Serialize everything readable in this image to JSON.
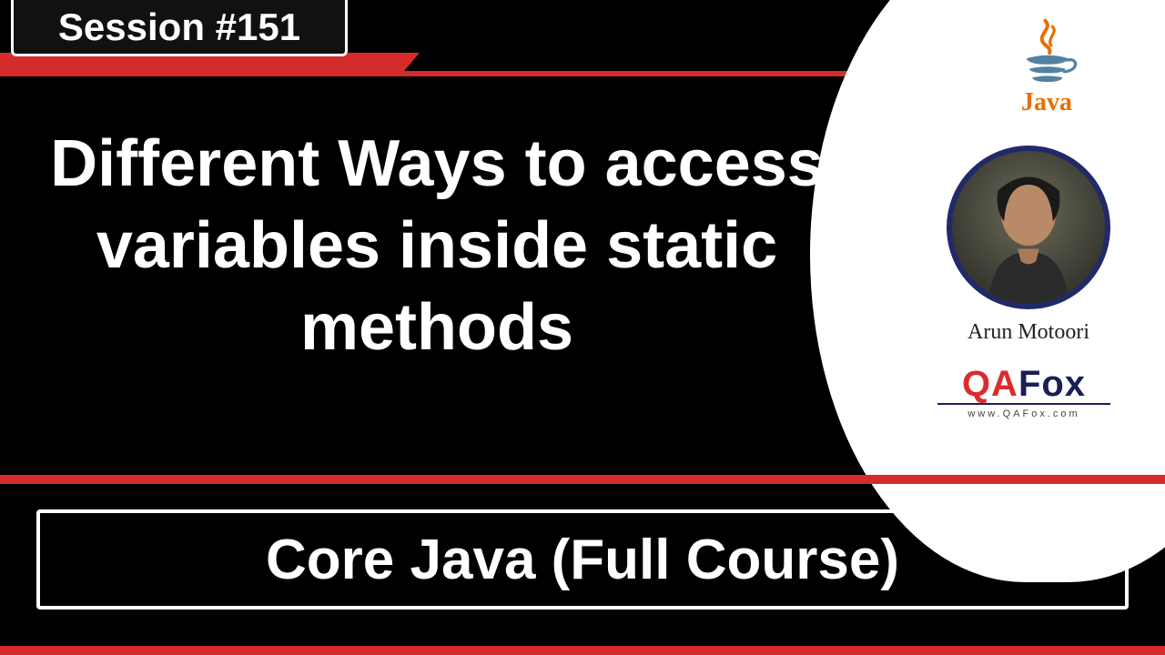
{
  "session": {
    "label": "Session #151"
  },
  "title": "Different Ways to access variables inside static methods",
  "author": {
    "name": "Arun Motoori"
  },
  "brand": {
    "java_text": "Java",
    "qafox_qa": "QA",
    "qafox_fox": "Fox",
    "qafox_url": "www.QAFox.com"
  },
  "footer": {
    "course": "Core Java (Full Course)"
  }
}
